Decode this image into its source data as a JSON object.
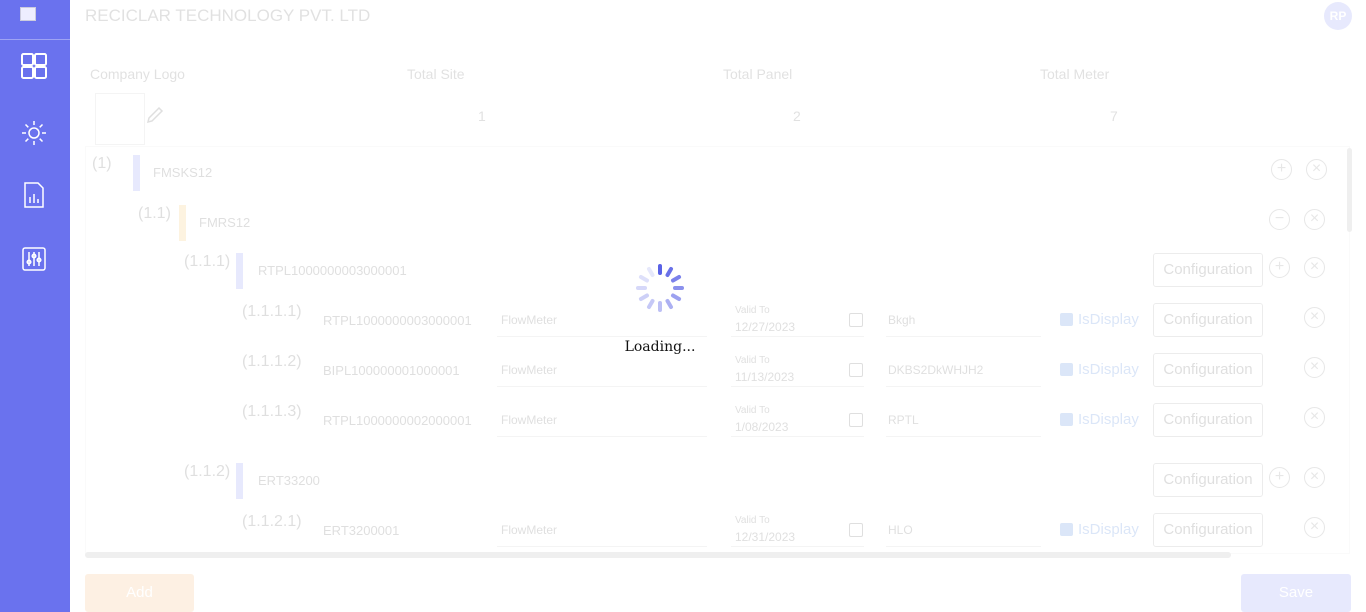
{
  "app": {
    "company_name": "RECICLAR TECHNOLOGY PVT. LTD",
    "user_initials": "RP",
    "brand_color": "#6a72ee"
  },
  "sidebar": {
    "items": [
      {
        "icon": "dashboard-grid-icon"
      },
      {
        "icon": "settings-gears-icon"
      },
      {
        "icon": "report-chart-icon"
      },
      {
        "icon": "sliders-config-icon"
      }
    ]
  },
  "stats": {
    "headers": [
      "Company Logo",
      "Total Site",
      "Total Panel",
      "Total Meter"
    ],
    "values": [
      "1",
      "2",
      "7"
    ]
  },
  "tree": {
    "rows": [
      {
        "index": "(1)",
        "code": "FMSKS12",
        "bar_color": "#6a72ee"
      },
      {
        "index": "(1.1)",
        "code": "FMRS12",
        "bar_color": "#f2b43a"
      },
      {
        "index": "(1.1.1)",
        "code": "RTPL1000000003000001",
        "bar_color": "#6a72ee",
        "config_label": "Configuration"
      },
      {
        "index": "(1.1.1.1)",
        "code": "RTPL1000000003000001",
        "type": "FlowMeter",
        "date_label": "Valid To",
        "date": "12/27/2023",
        "name": "Bkgh",
        "display_label": "IsDisplay",
        "config_label": "Configuration"
      },
      {
        "index": "(1.1.1.2)",
        "code": "BIPL100000001000001",
        "type": "FlowMeter",
        "date_label": "Valid To",
        "date": "11/13/2023",
        "name": "DKBS2DkWHJH2",
        "display_label": "IsDisplay",
        "config_label": "Configuration"
      },
      {
        "index": "(1.1.1.3)",
        "code": "RTPL1000000002000001",
        "type": "FlowMeter",
        "date_label": "Valid To",
        "date": "1/08/2023",
        "name": "RPTL",
        "display_label": "IsDisplay",
        "config_label": "Configuration"
      },
      {
        "index": "(1.1.2)",
        "code": "ERT33200",
        "bar_color": "#6a72ee",
        "config_label": "Configuration"
      },
      {
        "index": "(1.1.2.1)",
        "code": "ERT3200001",
        "type": "FlowMeter",
        "date_label": "Valid To",
        "date": "12/31/2023",
        "name": "HLO",
        "display_label": "IsDisplay",
        "config_label": "Configuration"
      }
    ]
  },
  "actions": {
    "add_label": "Add",
    "save_label": "Save"
  },
  "loader": {
    "text": "Loading..."
  }
}
